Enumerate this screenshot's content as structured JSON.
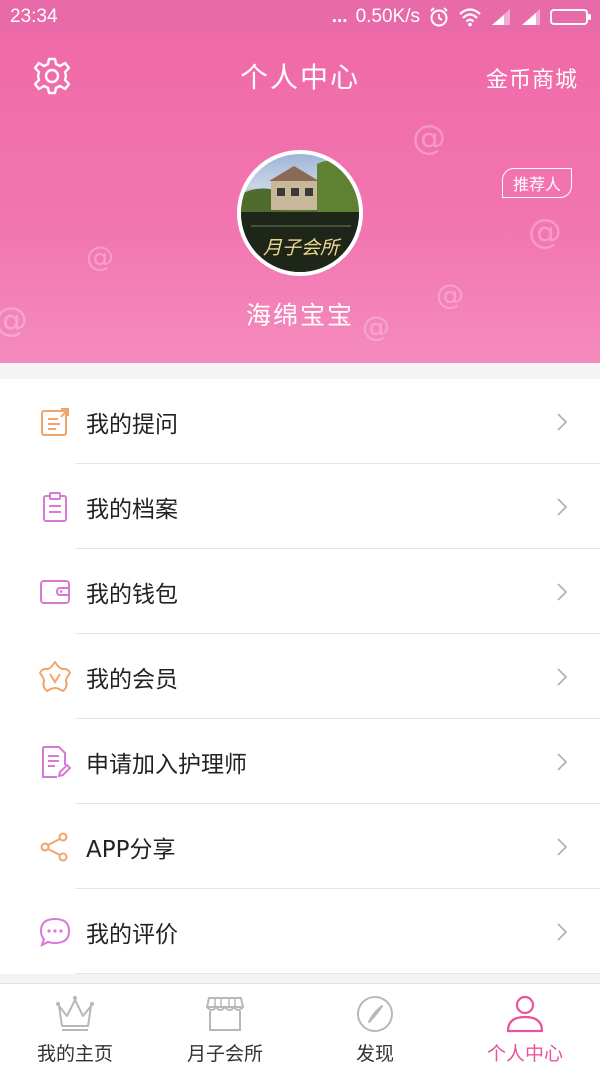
{
  "status_bar": {
    "time": "23:34",
    "dots": "...",
    "network_speed": "0.50K/s",
    "icons": [
      "alarm-icon",
      "wifi-icon",
      "signal-icon",
      "signal-icon",
      "battery-icon"
    ]
  },
  "header": {
    "title": "个人中心",
    "right_link": "金币商城",
    "settings_icon": "gear-icon",
    "referrer_label": "推荐人",
    "username": "海绵宝宝",
    "avatar_caption": "月子会所",
    "background_color": "#f06aa7"
  },
  "menu": {
    "items": [
      {
        "label": "我的提问",
        "icon": "edit-note-icon",
        "icon_color": "#f0a36a"
      },
      {
        "label": "我的档案",
        "icon": "clipboard-icon",
        "icon_color": "#d879d6"
      },
      {
        "label": "我的钱包",
        "icon": "wallet-icon",
        "icon_color": "#d879d6"
      },
      {
        "label": "我的会员",
        "icon": "flower-badge-icon",
        "icon_color": "#f0a36a"
      },
      {
        "label": "申请加入护理师",
        "icon": "document-pen-icon",
        "icon_color": "#d879d6"
      },
      {
        "label": "APP分享",
        "icon": "share-icon",
        "icon_color": "#f0a36a"
      },
      {
        "label": "我的评价",
        "icon": "chat-bubble-icon",
        "icon_color": "#d879d6"
      }
    ]
  },
  "tabbar": {
    "tabs": [
      {
        "label": "我的主页",
        "icon": "crown-icon",
        "active": false
      },
      {
        "label": "月子会所",
        "icon": "storefront-icon",
        "active": false
      },
      {
        "label": "发现",
        "icon": "compass-icon",
        "active": false
      },
      {
        "label": "个人中心",
        "icon": "person-icon",
        "active": true
      }
    ],
    "active_color": "#e8539b"
  }
}
